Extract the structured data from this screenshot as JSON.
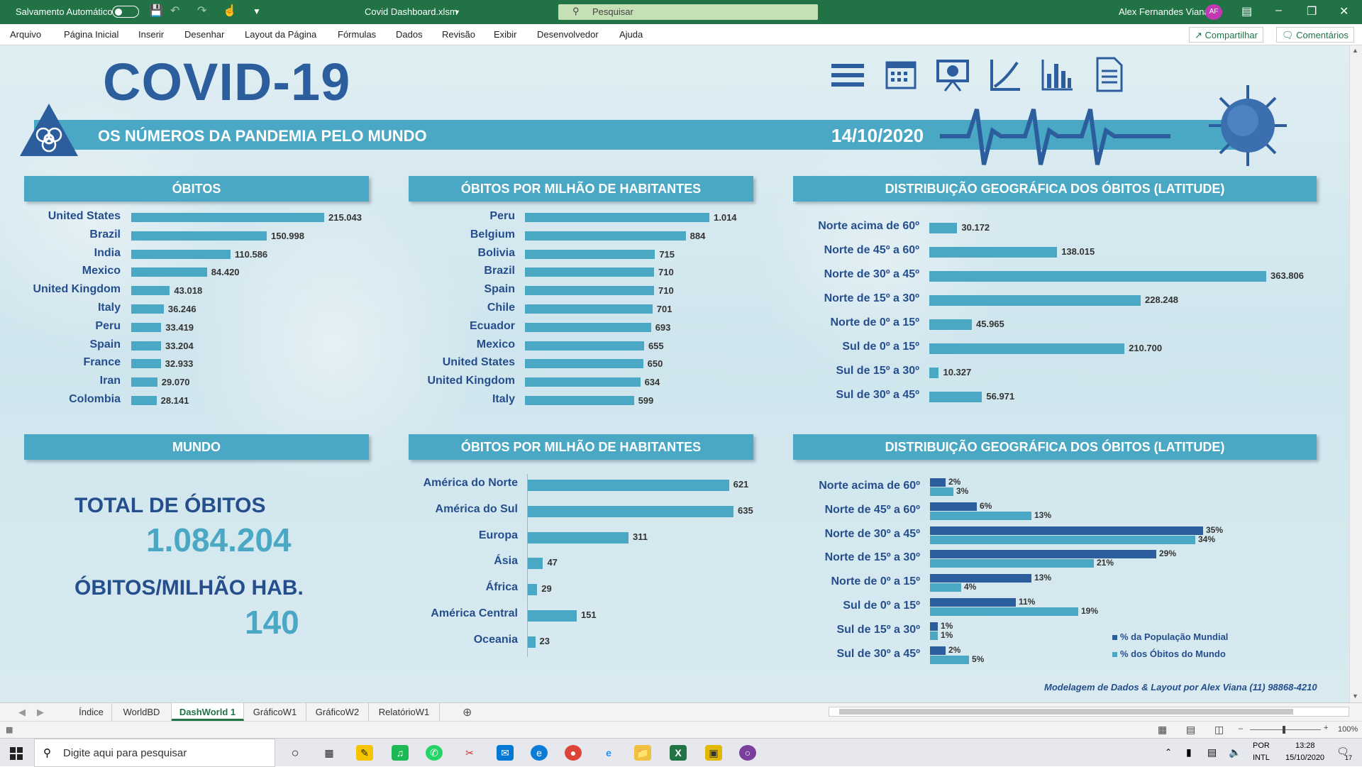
{
  "titlebar": {
    "autosave": "Salvamento Automático",
    "filename": "Covid Dashboard.xlsm",
    "search_placeholder": "Pesquisar",
    "user": "Alex Fernandes Viana",
    "initials": "AF"
  },
  "ribbon": {
    "menu": [
      "Arquivo",
      "Página Inicial",
      "Inserir",
      "Desenhar",
      "Layout da Página",
      "Fórmulas",
      "Dados",
      "Revisão",
      "Exibir",
      "Desenvolvedor",
      "Ajuda"
    ],
    "share": "Compartilhar",
    "comments": "Comentários"
  },
  "dashboard": {
    "title": "COVID-19",
    "subtitle": "OS NÚMEROS DA PANDEMIA PELO MUNDO",
    "date": "14/10/2020",
    "nav_icons": [
      "menu-icon",
      "calendar-icon",
      "presentation-icon",
      "line-chart-icon",
      "bar-chart-icon",
      "document-icon"
    ],
    "world": {
      "header": "MUNDO",
      "total_label": "TOTAL DE ÓBITOS",
      "total_value": "1.084.204",
      "per_million_label": "ÓBITOS/MILHÃO HAB.",
      "per_million_value": "140"
    },
    "credit": "Modelagem de Dados & Layout por Alex Viana (11) 98868-4210"
  },
  "chart_data": [
    {
      "type": "bar",
      "title": "ÓBITOS",
      "categories": [
        "United States",
        "Brazil",
        "India",
        "Mexico",
        "United Kingdom",
        "Italy",
        "Peru",
        "Spain",
        "France",
        "Iran",
        "Colombia"
      ],
      "values": [
        215043,
        150998,
        110586,
        84420,
        43018,
        36246,
        33419,
        33204,
        32933,
        29070,
        28141
      ],
      "labels": [
        "215.043",
        "150.998",
        "110.586",
        "84.420",
        "43.018",
        "36.246",
        "33.419",
        "33.204",
        "32.933",
        "29.070",
        "28.141"
      ]
    },
    {
      "type": "bar",
      "title": "ÓBITOS POR MILHÃO DE HABITANTES",
      "categories": [
        "Peru",
        "Belgium",
        "Bolivia",
        "Brazil",
        "Spain",
        "Chile",
        "Ecuador",
        "Mexico",
        "United States",
        "United Kingdom",
        "Italy"
      ],
      "values": [
        1014,
        884,
        715,
        710,
        710,
        701,
        693,
        655,
        650,
        634,
        599
      ],
      "labels": [
        "1.014",
        "884",
        "715",
        "710",
        "710",
        "701",
        "693",
        "655",
        "650",
        "634",
        "599"
      ]
    },
    {
      "type": "bar",
      "title": "DISTRIBUIÇÃO GEOGRÁFICA DOS ÓBITOS (LATITUDE)",
      "categories": [
        "Norte acima de 60º",
        "Norte de 45º a 60º",
        "Norte de 30º a 45º",
        "Norte de 15º a 30º",
        "Norte de 0º a 15º",
        "Sul de 0º a 15º",
        "Sul de 15º a 30º",
        "Sul de 30º a 45º"
      ],
      "values": [
        30172,
        138015,
        363806,
        228248,
        45965,
        210700,
        10327,
        56971
      ],
      "labels": [
        "30.172",
        "138.015",
        "363.806",
        "228.248",
        "45.965",
        "210.700",
        "10.327",
        "56.971"
      ]
    },
    {
      "type": "bar",
      "title": "ÓBITOS POR MILHÃO DE HABITANTES",
      "categories": [
        "América do Norte",
        "América do Sul",
        "Europa",
        "Ásia",
        "África",
        "América Central",
        "Oceania"
      ],
      "values": [
        621,
        635,
        311,
        47,
        29,
        151,
        23
      ],
      "labels": [
        "621",
        "635",
        "311",
        "47",
        "29",
        "151",
        "23"
      ]
    },
    {
      "type": "bar",
      "title": "DISTRIBUIÇÃO GEOGRÁFICA DOS ÓBITOS (LATITUDE)",
      "categories": [
        "Norte acima de 60º",
        "Norte de 45º a 60º",
        "Norte de 30º a 45º",
        "Norte de 15º a 30º",
        "Norte de 0º a 15º",
        "Sul de 0º a 15º",
        "Sul de 15º a 30º",
        "Sul de 30º a 45º"
      ],
      "series": [
        {
          "name": "% da População Mundial",
          "values": [
            2,
            6,
            35,
            29,
            13,
            11,
            1,
            2
          ],
          "color": "#2c5e9e"
        },
        {
          "name": "% dos Óbitos do Mundo",
          "values": [
            3,
            13,
            34,
            21,
            4,
            19,
            1,
            5
          ],
          "color": "#4ba8c5"
        }
      ]
    }
  ],
  "sheet_tabs": [
    "Índice",
    "WorldBD",
    "DashWorld 1",
    "GráficoW1",
    "GráficoW2",
    "RelatórioW1"
  ],
  "active_tab": "DashWorld 1",
  "status": {
    "zoom": "100%"
  },
  "taskbar": {
    "search_placeholder": "Digite aqui para pesquisar",
    "lang": "POR",
    "layout": "INTL",
    "time": "13:28",
    "date": "15/10/2020",
    "notifications": "17"
  }
}
